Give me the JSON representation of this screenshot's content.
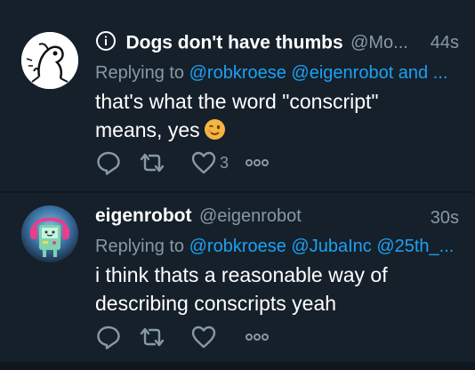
{
  "tweets": [
    {
      "display_name": "Dogs don't have thumbs",
      "handle": "@Mo...",
      "timestamp": "44s",
      "replying_prefix": "Replying to",
      "replying_mentions": "@robkroese @eigenrobot and ...",
      "body_line1": "that's what the word \"conscript\"",
      "body_line2": "means, yes",
      "like_count": "3",
      "icons": [
        "info-icon",
        "wink-emoji-icon",
        "reply-icon",
        "retweet-icon",
        "like-icon",
        "more-icon"
      ]
    },
    {
      "display_name": "eigenrobot",
      "handle": "@eigenrobot",
      "timestamp": "30s",
      "replying_prefix": "Replying to",
      "replying_mentions": "@robkroese @JubaInc @25th_...",
      "body_line1": "i think thats a reasonable way of",
      "body_line2": "describing conscripts yeah",
      "like_count": "",
      "icons": [
        "reply-icon",
        "retweet-icon",
        "like-icon",
        "more-icon"
      ]
    }
  ],
  "colors": {
    "background": "#15202b",
    "text": "#ffffff",
    "secondary": "#8899a6",
    "link": "#1da1f2"
  }
}
